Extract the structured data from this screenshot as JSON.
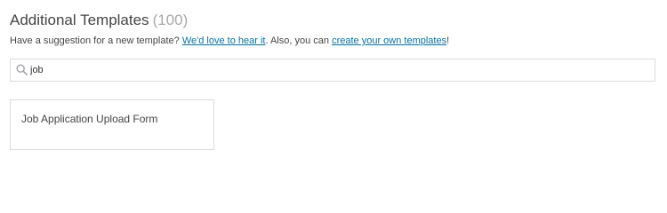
{
  "header": {
    "title": "Additional Templates",
    "count": "(100)"
  },
  "suggestion": {
    "prefix": "Have a suggestion for a new template? ",
    "link1": "We'd love to hear it",
    "middle": ". Also, you can ",
    "link2": "create your own templates",
    "suffix": "!"
  },
  "search": {
    "value": "job",
    "icon": "search-icon"
  },
  "templates": [
    {
      "title": "Job Application Upload Form"
    }
  ]
}
